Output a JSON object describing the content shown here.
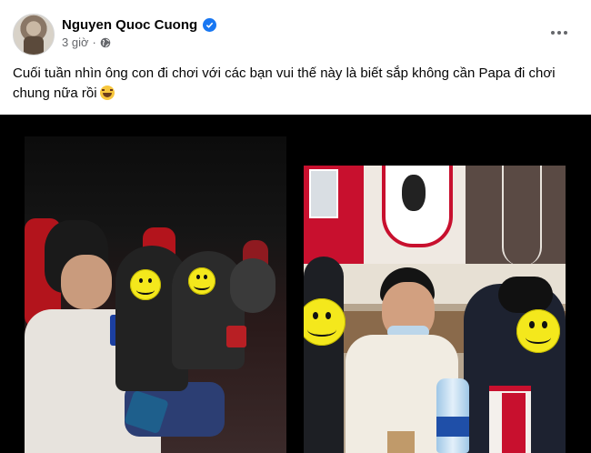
{
  "post": {
    "author": "Nguyen Quoc Cuong",
    "time": "3 giờ",
    "separator": "·",
    "caption": "Cuối tuần nhìn ông con đi chơi với các bạn vui thế này là biết sắp không cần Papa đi chơi chung nữa rồi"
  },
  "icons": {
    "verified": "verified-badge-icon",
    "privacy": "globe-icon",
    "more": "more-options-icon",
    "emoji": "laughing-crying-emoji"
  },
  "colors": {
    "brand_blue": "#1877f2",
    "text_primary": "#050505",
    "text_secondary": "#65676b",
    "smiley_yellow": "#f4e81c",
    "kfc_red": "#c8102e"
  }
}
